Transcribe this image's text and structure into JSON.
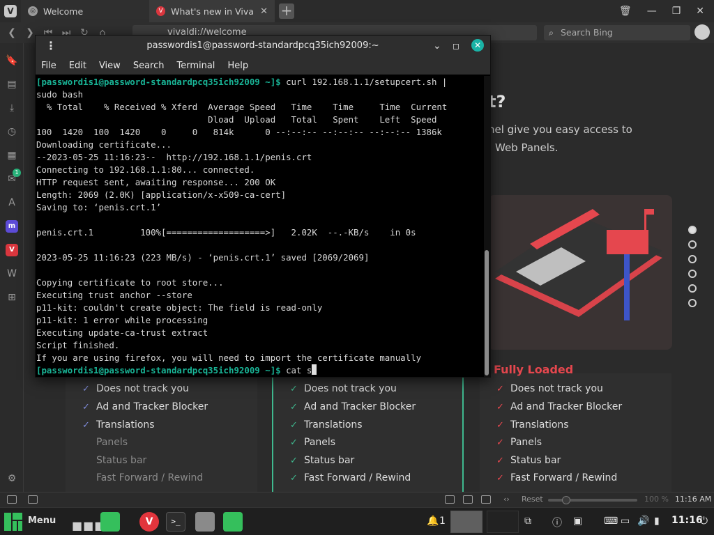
{
  "browser": {
    "tabs": [
      {
        "label": "Welcome"
      },
      {
        "label": "What's new in Vivaldi | Viva"
      }
    ],
    "url": "vivaldi://welcome",
    "search_placeholder": "Search Bing"
  },
  "welcome": {
    "heading_fragment": "t?",
    "desc_line1": "nel give you easy access to",
    "desc_line2": "Web Panels.",
    "fully_loaded_title": "Fully Loaded",
    "columns": [
      {
        "features": [
          {
            "label": "Does not track you",
            "on": true
          },
          {
            "label": "Ad and Tracker Blocker",
            "on": true
          },
          {
            "label": "Translations",
            "on": true
          },
          {
            "label": "Panels",
            "on": false
          },
          {
            "label": "Status bar",
            "on": false
          },
          {
            "label": "Fast Forward / Rewind",
            "on": false
          }
        ]
      },
      {
        "features": [
          {
            "label": "Does not track you",
            "on": true
          },
          {
            "label": "Ad and Tracker Blocker",
            "on": true
          },
          {
            "label": "Translations",
            "on": true
          },
          {
            "label": "Panels",
            "on": true
          },
          {
            "label": "Status bar",
            "on": true
          },
          {
            "label": "Fast Forward / Rewind",
            "on": true
          }
        ]
      },
      {
        "features": [
          {
            "label": "Does not track you",
            "on": true
          },
          {
            "label": "Ad and Tracker Blocker",
            "on": true
          },
          {
            "label": "Translations",
            "on": true
          },
          {
            "label": "Panels",
            "on": true
          },
          {
            "label": "Status bar",
            "on": true
          },
          {
            "label": "Fast Forward / Rewind",
            "on": true
          }
        ]
      }
    ]
  },
  "statusbar": {
    "reset": "Reset",
    "zoom": "100 %",
    "time": "11:16 AM"
  },
  "terminal": {
    "title": "passwordis1@password-standardpcq35ich92009:~",
    "menu": [
      "File",
      "Edit",
      "View",
      "Search",
      "Terminal",
      "Help"
    ],
    "prompt": "[passwordis1@password-standardpcq35ich92009 ~]$",
    "command1": " curl 192.168.1.1/setupcert.sh |",
    "lines": [
      "sudo bash",
      "  % Total    % Received % Xferd  Average Speed   Time    Time     Time  Current",
      "                                 Dload  Upload   Total   Spent    Left  Speed",
      "100  1420  100  1420    0     0   814k      0 --:--:-- --:--:-- --:--:-- 1386k",
      "Downloading certificate...",
      "--2023-05-25 11:16:23--  http://192.168.1.1/penis.crt",
      "Connecting to 192.168.1.1:80... connected.",
      "HTTP request sent, awaiting response... 200 OK",
      "Length: 2069 (2.0K) [application/x-x509-ca-cert]",
      "Saving to: ‘penis.crt.1’",
      "",
      "penis.crt.1         100%[===================>]   2.02K  --.-KB/s    in 0s",
      "",
      "2023-05-25 11:16:23 (223 MB/s) - ‘penis.crt.1’ saved [2069/2069]",
      "",
      "Copying certificate to root store...",
      "Executing trust anchor --store",
      "p11-kit: couldn't create object: The field is read-only",
      "p11-kit: 1 error while processing",
      "Executing update-ca-trust extract",
      "Script finished.",
      "If you are using firefox, you will need to import the certificate manually"
    ],
    "command2": " cat s"
  },
  "taskbar": {
    "menu_label": "Menu",
    "workspace_count": "1",
    "time": "11:16"
  },
  "colors": {
    "prompt": "#19b597",
    "vivaldi_red": "#e5474e",
    "check_green": "#3fb98f",
    "check_blue": "#7f8bd9"
  }
}
